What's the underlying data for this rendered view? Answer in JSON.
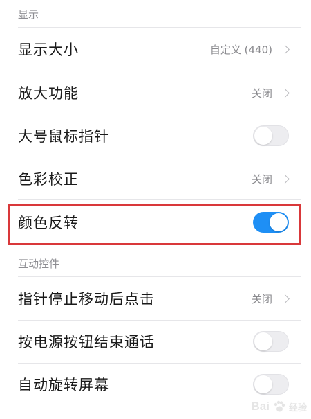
{
  "sections": {
    "display": {
      "title": "显示"
    },
    "interaction": {
      "title": "互动控件"
    }
  },
  "rows": {
    "display_size": {
      "label": "显示大小",
      "value": "自定义 (440)"
    },
    "magnification": {
      "label": "放大功能",
      "value": "关闭"
    },
    "large_pointer": {
      "label": "大号鼠标指针",
      "toggle": false
    },
    "color_correction": {
      "label": "色彩校正",
      "value": "关闭"
    },
    "color_inversion": {
      "label": "颜色反转",
      "toggle": true
    },
    "click_after_pointer_stops": {
      "label": "指针停止移动后点击",
      "value": "关闭"
    },
    "power_button_ends_call": {
      "label": "按电源按钮结束通话",
      "toggle": false
    },
    "auto_rotate": {
      "label": "自动旋转屏幕",
      "toggle": false
    }
  },
  "colors": {
    "toggle_on": "#1e8ff5",
    "highlight_border": "#d9383a"
  },
  "watermark": {
    "text": "Bai",
    "suffix": "经验"
  }
}
